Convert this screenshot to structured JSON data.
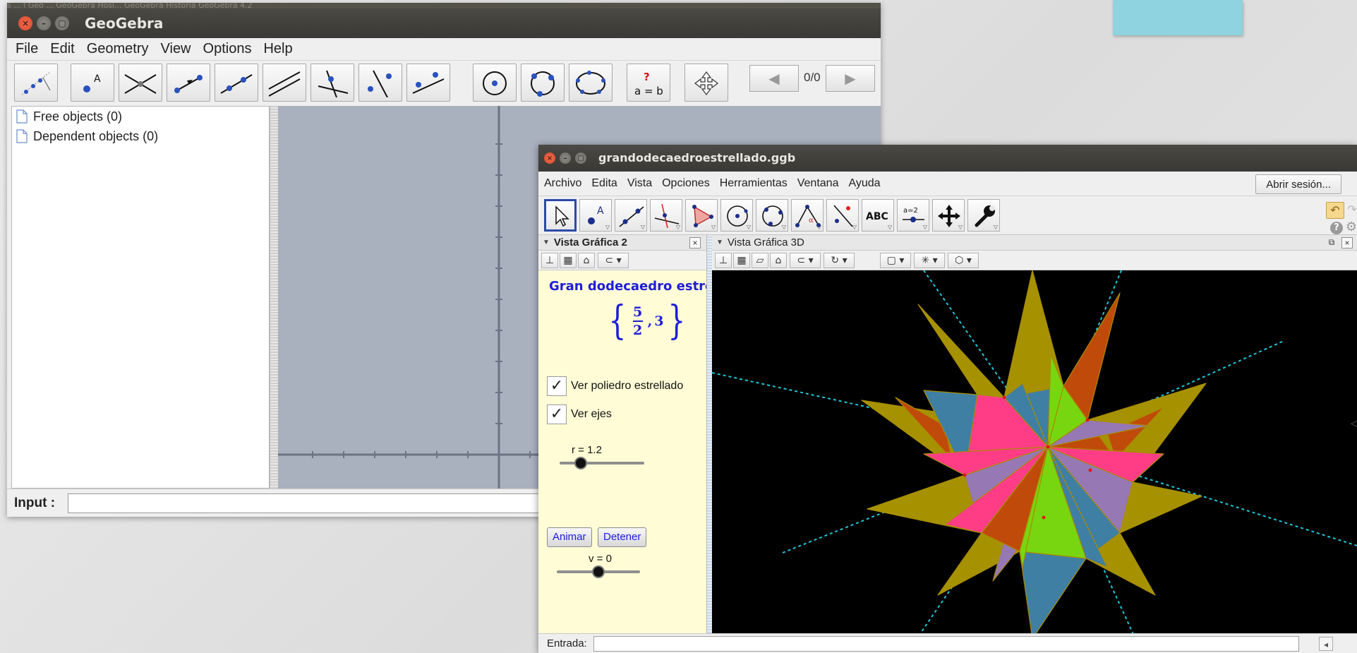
{
  "colors": {
    "sticky_note": "#8fd3e0",
    "titlebar": "#3f3d39",
    "graphics_view_bg": "#a9b0be",
    "yellow_panel": "#fffcd6",
    "title_blue": "#1d1dd8",
    "canvas_3d_bg": "#000000",
    "poly_olive": "#a69200",
    "poly_pink": "#ff3d86",
    "poly_steel": "#3f7fa3",
    "poly_orange": "#c04a0a",
    "poly_purple": "#9678b4",
    "poly_green": "#78d610",
    "axis_cyan": "#1fc8d8"
  },
  "window1": {
    "background_strip_text": "s ... l   Geo ...   GeoGebra Hosi...   GeoGebra Historia   GeoGebra 4.2",
    "title": "GeoGebra",
    "menu": [
      "File",
      "Edit",
      "Geometry",
      "View",
      "Options",
      "Help"
    ],
    "toolbar_icons": [
      "move-graphics-icon",
      "new-point-icon",
      "intersect-icon",
      "vector-icon",
      "line-icon",
      "parallel-icon",
      "perpendicular-icon",
      "perpendicular-bisector-icon",
      "line-through-points-icon",
      "circle-center-icon",
      "circle-three-points-icon",
      "conic-five-points-icon",
      "relation-icon",
      "move-view-icon"
    ],
    "nav": {
      "prev": "◀",
      "count": "0/0",
      "next": "▶"
    },
    "algebra": {
      "free_objects": "Free objects (0)",
      "dependent_objects": "Dependent objects (0)"
    },
    "input_label": "Input :"
  },
  "window2": {
    "title": "grandodecaedroestrellado.ggb",
    "menu": [
      "Archivo",
      "Edita",
      "Vista",
      "Opciones",
      "Herramientas",
      "Ventana",
      "Ayuda"
    ],
    "login_button": "Abrir sesión...",
    "toolbar_icons": [
      "move-arrow-icon",
      "point-icon",
      "line-icon",
      "perpendicular-icon",
      "polygon-icon",
      "circle-icon",
      "circle-three-points-icon",
      "angle-icon",
      "reflect-icon",
      "text-icon",
      "slider-icon",
      "move-view-icon",
      "tools-icon"
    ],
    "toolbar_text": {
      "text_tool": "ABC",
      "slider_tool": "a=2"
    },
    "view2": {
      "header": "Vista Gráfica 2",
      "title": "Gran dodecaedro estrellado",
      "schlafli": {
        "numerator": "5",
        "denominator": "2",
        "second": "3"
      },
      "checkboxes": [
        {
          "label": "Ver poliedro estrellado",
          "checked": true
        },
        {
          "label": "Ver ejes",
          "checked": true
        }
      ],
      "slider_r": {
        "label": "r = 1.2",
        "value": 0.25
      },
      "buttons": {
        "animate": "Animar",
        "stop": "Detener"
      },
      "slider_v": {
        "label": "v = 0",
        "value": 0.5
      }
    },
    "view3d": {
      "header": "Vista Gráfica 3D"
    },
    "input_label": "Entrada:"
  }
}
